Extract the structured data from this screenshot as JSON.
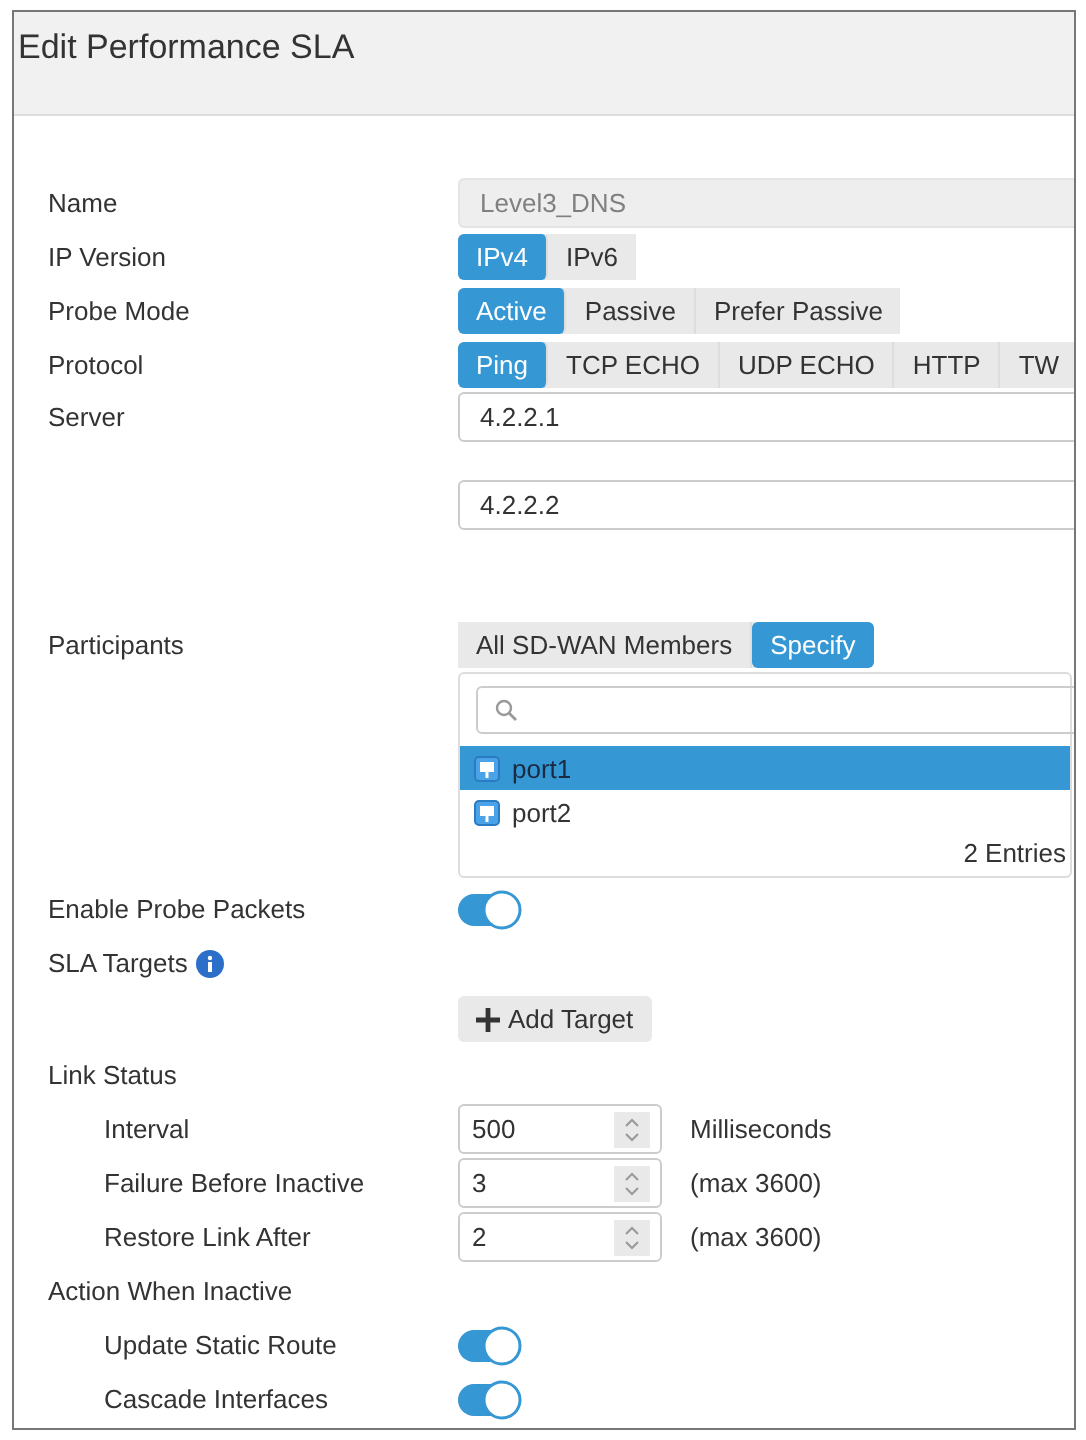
{
  "dialog": {
    "title": "Edit Performance SLA"
  },
  "rows": [
    {
      "kind": "text",
      "label": "Name",
      "value": "Level3_DNS",
      "disabled": true
    },
    {
      "kind": "segmented",
      "label": "IP Version",
      "options": [
        {
          "label": "IPv4",
          "selected": true
        },
        {
          "label": "IPv6",
          "selected": false
        }
      ]
    },
    {
      "kind": "segmented",
      "label": "Probe Mode",
      "options": [
        {
          "label": "Active",
          "selected": true
        },
        {
          "label": "Passive",
          "selected": false
        },
        {
          "label": "Prefer Passive",
          "selected": false
        }
      ]
    },
    {
      "kind": "segmented",
      "label": "Protocol",
      "options": [
        {
          "label": "Ping",
          "selected": true
        },
        {
          "label": "TCP ECHO",
          "selected": false
        },
        {
          "label": "UDP ECHO",
          "selected": false
        },
        {
          "label": "HTTP",
          "selected": false
        },
        {
          "label": "TW",
          "selected": false
        }
      ]
    },
    {
      "kind": "inputs",
      "label": "Server",
      "values": [
        "4.2.2.1",
        "4.2.2.2"
      ]
    },
    {
      "kind": "segmented",
      "label": "Participants",
      "options": [
        {
          "label": "All SD-WAN Members",
          "selected": false
        },
        {
          "label": "Specify",
          "selected": true
        }
      ]
    },
    {
      "kind": "picklist",
      "entries": [
        {
          "label": "port1",
          "selected": true
        },
        {
          "label": "port2",
          "selected": false
        }
      ],
      "count": "2 Entries"
    },
    {
      "kind": "toggle",
      "label": "Enable Probe Packets",
      "on": true
    },
    {
      "kind": "info-heading",
      "label": "SLA Targets"
    },
    {
      "kind": "button",
      "label": "Add Target"
    },
    {
      "kind": "heading",
      "label": "Link Status",
      "children": [
        {
          "kind": "number",
          "label": "Interval",
          "value": "500",
          "note": "Milliseconds"
        },
        {
          "kind": "number",
          "label": "Failure Before Inactive",
          "value": "3",
          "note": "(max 3600)"
        },
        {
          "kind": "number",
          "label": "Restore Link After",
          "value": "2",
          "note": "(max 3600)"
        }
      ]
    },
    {
      "kind": "heading",
      "label": "Action When Inactive",
      "children": [
        {
          "kind": "toggle",
          "label": "Update Static Route",
          "on": true
        },
        {
          "kind": "toggle",
          "label": "Cascade Interfaces",
          "on": true
        }
      ]
    }
  ]
}
